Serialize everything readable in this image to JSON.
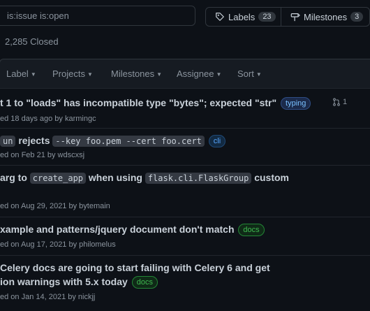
{
  "search": {
    "value": "is:issue is:open"
  },
  "toolbar": {
    "labels_label": "Labels",
    "labels_count": "23",
    "milestones_label": "Milestones",
    "milestones_count": "3"
  },
  "states": {
    "closed": "2,285 Closed"
  },
  "filters": {
    "label": "Label",
    "projects": "Projects",
    "milestones": "Milestones",
    "assignee": "Assignee",
    "sort": "Sort"
  },
  "issues": [
    {
      "title": "t 1 to \"loads\" has incompatible type \"bytes\"; expected \"str\"",
      "label": "typing",
      "meta": "ed 18 days ago by karmingc",
      "pr_count": "1"
    },
    {
      "title_code1": "un",
      "title_text": "rejects",
      "title_code2": "--key foo.pem --cert foo.cert",
      "label": "cli",
      "meta": "ed on Feb 21 by wdscxsj"
    },
    {
      "title_text1": "arg to",
      "title_code1": "create_app",
      "title_text2": "when using",
      "title_code2": "flask.cli.FlaskGroup",
      "title_text3": "custom",
      "meta": "ed on Aug 29, 2021 by bytemain"
    },
    {
      "title": "xample and patterns/jquery document don't match",
      "label": "docs",
      "meta": "ed on Aug 17, 2021 by philomelus"
    },
    {
      "title_line1": "Celery docs are going to start failing with Celery 6 and get",
      "title_line2": "ion warnings with 5.x today",
      "label": "docs",
      "meta": "ed on Jan 14, 2021 by nickjj"
    }
  ]
}
